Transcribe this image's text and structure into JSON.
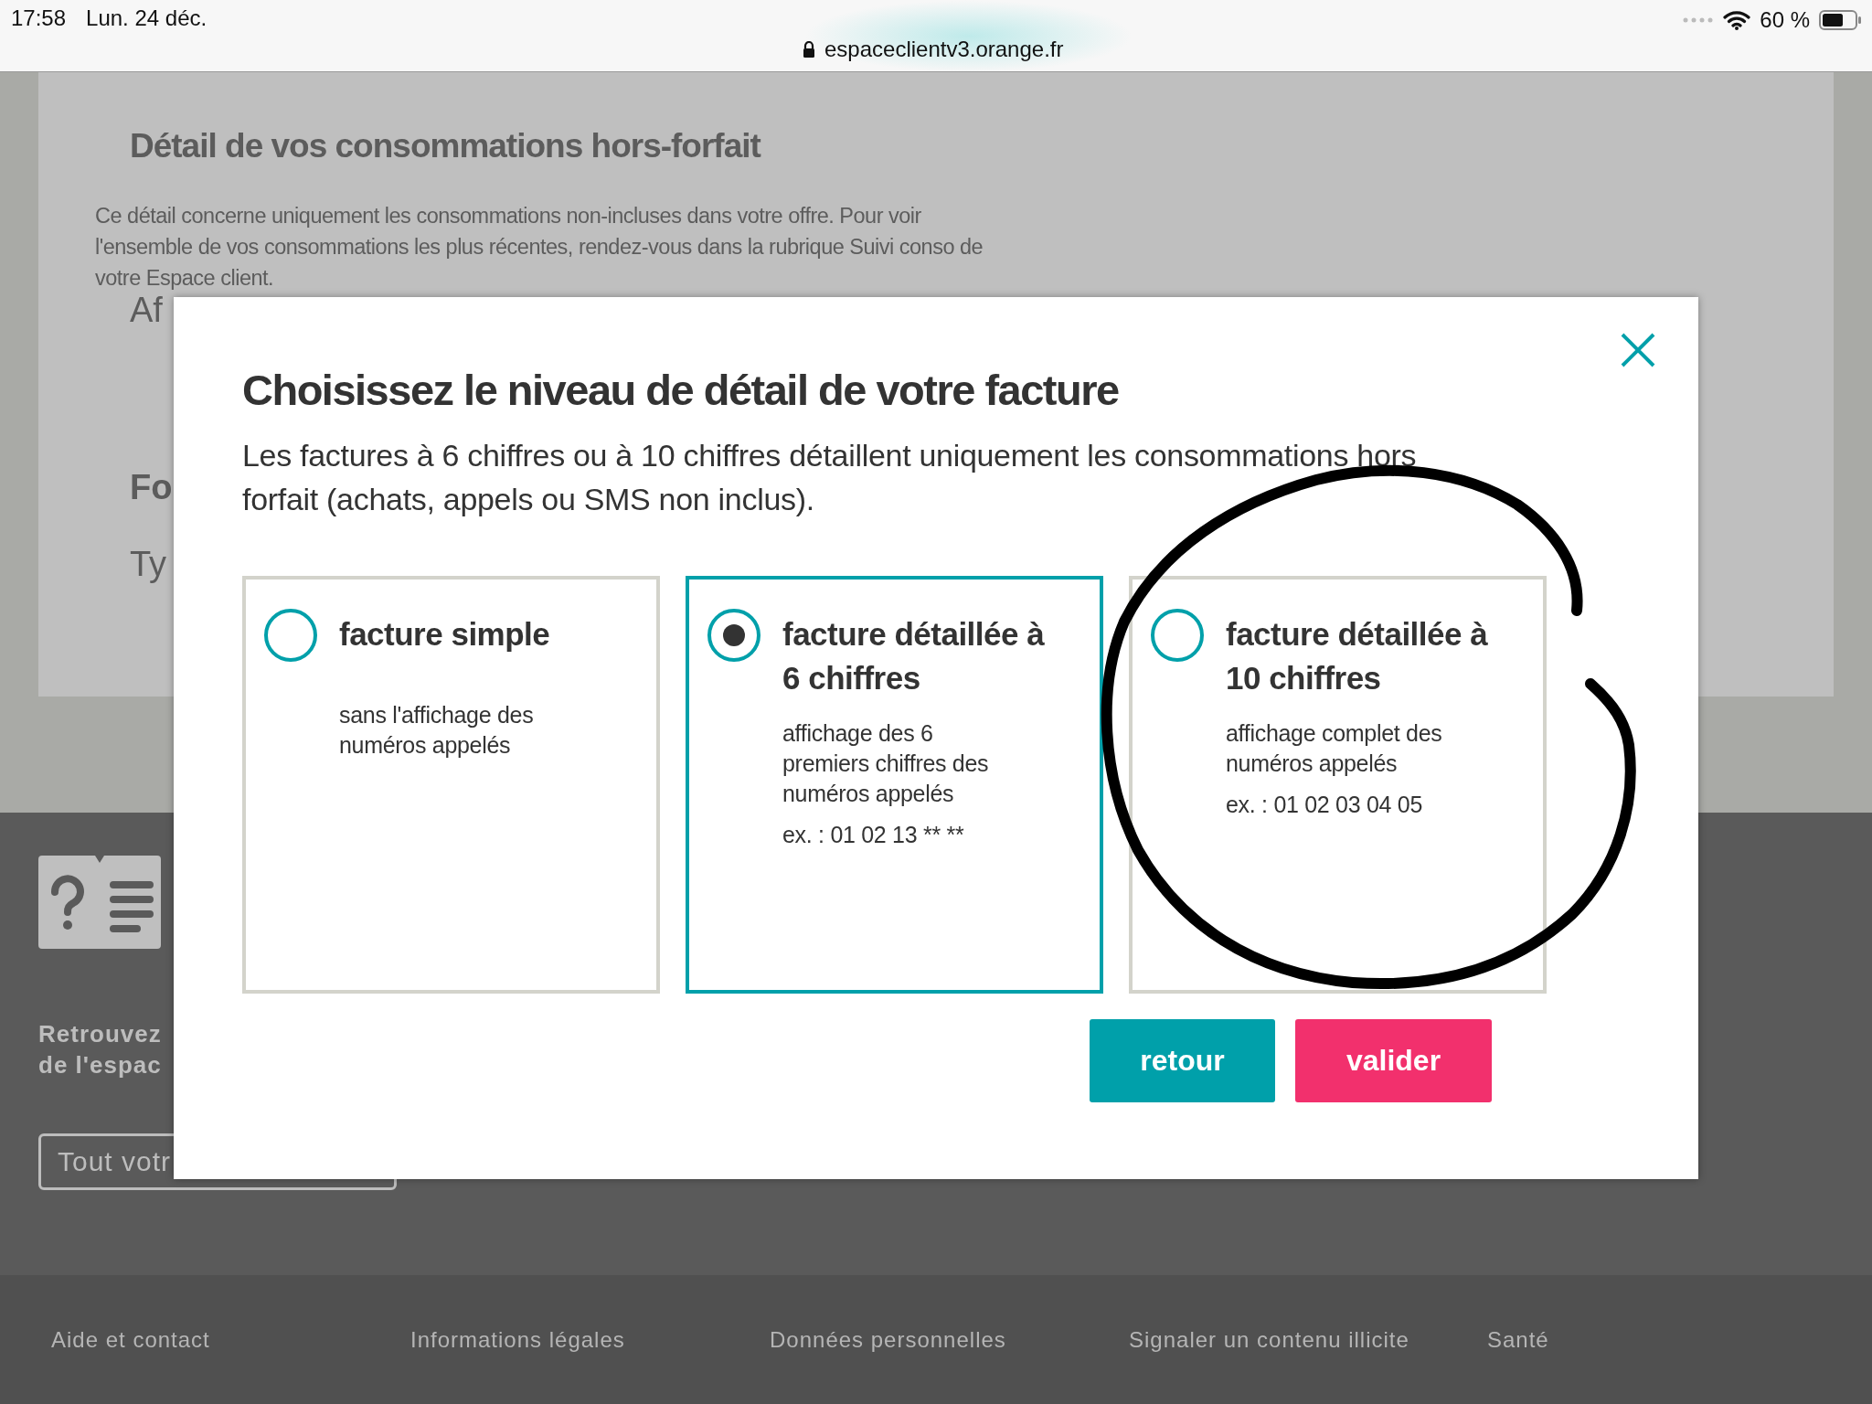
{
  "status_bar": {
    "time": "17:58",
    "date": "Lun. 24 déc.",
    "url": "espaceclientv3.orange.fr",
    "battery": "60 %"
  },
  "background": {
    "heading": "Détail de vos consommations hors-forfait",
    "paragraph": "Ce détail concerne uniquement les consommations non-incluses dans votre offre. Pour voir l'ensemble de vos consommations les plus récentes, rendez-vous dans la rubrique Suivi conso de votre Espace client.",
    "fragments": [
      {
        "text": "Af",
        "kind": "label"
      },
      {
        "text": "Fo",
        "kind": "heading"
      },
      {
        "text": "Ty",
        "kind": "label"
      }
    ],
    "help": {
      "lines": [
        "Retrouvez",
        "de l'espac"
      ],
      "button": "Tout votr"
    }
  },
  "modal": {
    "title": "Choisissez le niveau de détail de votre facture",
    "description": "Les factures à 6 chiffres ou à 10 chiffres détaillent uniquement les consommations hors forfait (achats, appels ou SMS non inclus).",
    "options": [
      {
        "title": "facture simple",
        "description": "sans l'affichage des numéros appelés",
        "selected": false
      },
      {
        "title": "facture détaillée à 6 chiffres",
        "description": "affichage des 6 premiers chiffres des numéros appelés",
        "example": "ex. : 01 02 13 ** **",
        "selected": true
      },
      {
        "title": "facture détaillée à 10 chiffres",
        "description": "affichage complet des numéros appelés",
        "example": "ex. : 01 02 03 04 05",
        "selected": false
      }
    ],
    "buttons": [
      {
        "label": "retour",
        "kind": "secondary"
      },
      {
        "label": "valider",
        "kind": "primary"
      }
    ]
  },
  "footer": {
    "links": [
      "Aide et contact",
      "Informations légales",
      "Données personnelles",
      "Signaler un contenu illicite",
      "Santé"
    ]
  }
}
